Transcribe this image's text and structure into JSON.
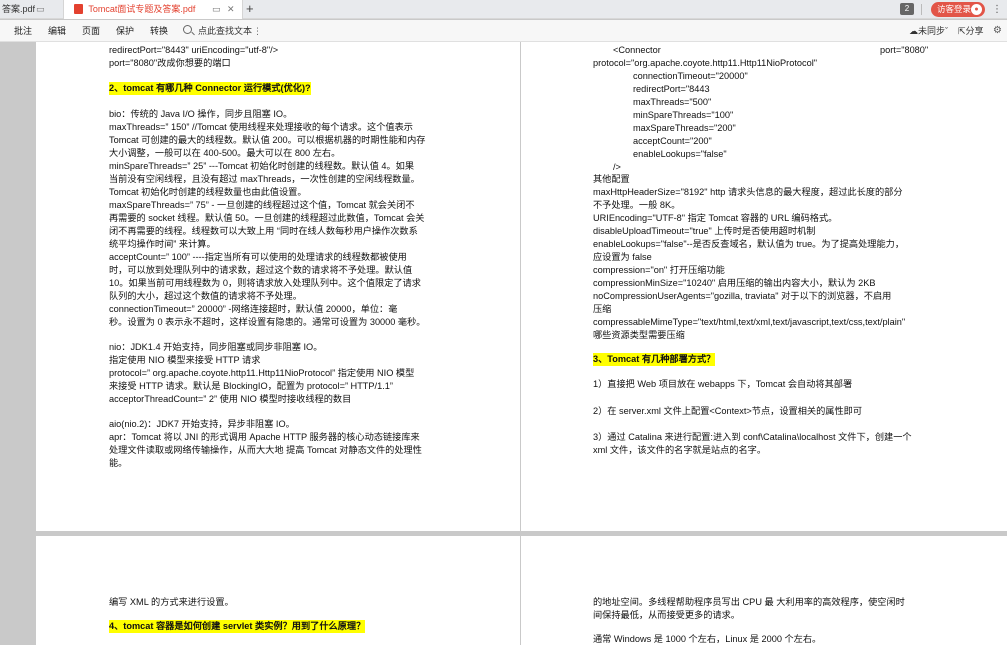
{
  "tabs": [
    {
      "label": "答案.pdf"
    },
    {
      "label": "Tomcat面试专题及答案.pdf"
    }
  ],
  "header": {
    "page_count": "2",
    "login_label": "访客登录"
  },
  "toolbar": {
    "items": [
      "批注",
      "编辑",
      "页面",
      "保护",
      "转换"
    ],
    "search_label": "点此查找文本",
    "sync_label": "未同步",
    "share_label": "分享"
  },
  "page1": {
    "lines": [
      "redirectPort=\"8443\" uriEncoding=\"utf-8\"/>",
      "port=\"8080\"改成你想要的端口",
      "2、tomcat 有哪几种 Connector 运行模式(优化)?",
      "bio：传统的 Java I/O 操作，同步且阻塞 IO。",
      "maxThreads=” 150” //Tomcat 使用线程来处理接收的每个请求。这个值表示",
      "Tomcat 可创建的最大的线程数。默认值 200。可以根据机器的时期性能和内存",
      "大小调整，一般可以在 400-500。最大可以在 800 左右。",
      "minSpareThreads=” 25” ---Tomcat 初始化时创建的线程数。默认值 4。如果",
      "当前没有空闲线程，且没有超过 maxThreads，一次性创建的空闲线程数量。",
      "Tomcat 初始化时创建的线程数量也由此值设置。",
      "maxSpareThreads=” 75” - 一旦创建的线程超过这个值，Tomcat 就会关闭不",
      "再需要的 socket 线程。默认值 50。一旦创建的线程超过此数值，Tomcat 会关",
      "闭不再需要的线程。线程数可以大致上用 “同时在线人数每秒用户操作次数系",
      "统平均操作时间” 来计算。",
      "acceptCount=” 100” ----指定当所有可以使用的处理请求的线程数都被使用",
      "时，可以放到处理队列中的请求数，超过这个数的请求将不予处理。默认值",
      "10。如果当前可用线程数为 0，则将请求放入处理队列中。这个值限定了请求",
      "队列的大小，超过这个数值的请求将不予处理。",
      "connectionTimeout=” 20000”    -网络连接超时，默认值 20000，单位：毫",
      "秒。设置为 0 表示永不超时，这样设置有隐患的。通常可设置为 30000 毫秒。",
      "nio：JDK1.4 开始支持，同步阻塞或同步非阻塞 IO。",
      "指定使用 NIO 模型来接受 HTTP 请求",
      "protocol=” org.apache.coyote.http11.Http11NioProtocol” 指定使用 NIO 模型",
      "来接受 HTTP 请求。默认是 BlockingIO，配置为 protocol=” HTTP/1.1”",
      "acceptorThreadCount=” 2” 使用 NIO 模型时接收线程的数目",
      "aio(nio.2)：JDK7 开始支持，异步非阻塞 IO。",
      "apr：Tomcat 将以 JNI 的形式调用 Apache HTTP 服务器的核心动态链接库来",
      "处理文件读取或网络传输操作，从而大大地 提高 Tomcat 对静态文件的处理性",
      "能。"
    ]
  },
  "page2": {
    "connector_open": "<Connector",
    "connector_port": "port=\"8080\"",
    "lines": [
      "protocol=\"org.apache.coyote.http11.Http11NioProtocol\"",
      "connectionTimeout=\"20000\"",
      "redirectPort=\"8443",
      "maxThreads=\"500\"",
      "minSpareThreads=\"100\"",
      "maxSpareThreads=\"200\"",
      "acceptCount=\"200\"",
      "enableLookups=\"false\"",
      "/>",
      "其他配置",
      "maxHttpHeaderSize=\"8192\"   http 请求头信息的最大程度，超过此长度的部分",
      "不予处理。一般 8K。",
      "URIEncoding=\"UTF-8\" 指定 Tomcat 容器的 URL 编码格式。",
      "disableUploadTimeout=\"true\" 上传时是否使用超时机制",
      "enableLookups=\"false\"--是否反查域名，默认值为 true。为了提高处理能力，",
      "应设置为 false",
      "compression=\"on\"    打开压缩功能",
      "compressionMinSize=\"10240\" 启用压缩的输出内容大小，默认为 2KB",
      "noCompressionUserAgents=\"gozilla, traviata\"      对于以下的浏览器，不启用",
      "压缩",
      "compressableMimeType=\"text/html,text/xml,text/javascript,text/css,text/plain\"",
      "哪些资源类型需要压缩",
      "3、Tomcat 有几种部署方式？",
      "1）直接把 Web 项目放在 webapps 下，Tomcat 会自动将其部署",
      "2）在 server.xml 文件上配置<Context>节点，设置相关的属性即可",
      "3）通过 Catalina 来进行配置:进入到 conf\\Catalina\\localhost 文件下，创建一个",
      "xml 文件，该文件的名字就是站点的名字。"
    ]
  },
  "page3": {
    "lines": [
      "编写 XML 的方式来进行设置。",
      "4、tomcat 容器是如何创建 servlet 类实例？用到了什么原理？"
    ]
  },
  "page4": {
    "lines": [
      "的地址空间。多线程帮助程序员写出 CPU 最   大利用率的高效程序，使空闲时",
      "间保持最低，从而接受更多的请求。",
      "通常 Windows 是 1000 个左右，Linux 是 2000 个左右。"
    ]
  },
  "icons": [
    "pdf-icon",
    "close-icon",
    "add-tab-icon",
    "user-icon",
    "search-icon",
    "cloud-sync-icon",
    "share-icon",
    "settings-icon"
  ],
  "colors": {
    "accent": "#e25548",
    "pdf_red": "#e3412f",
    "highlight": "#ffff00"
  }
}
